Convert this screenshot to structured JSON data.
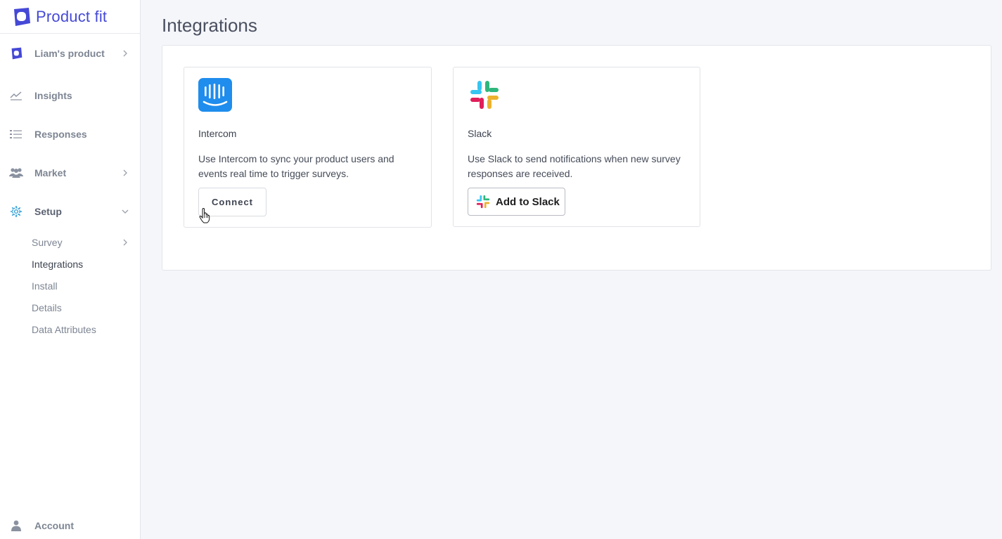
{
  "brand": {
    "name": "Product fit",
    "logo_icon": "product-fit-logo-icon",
    "color": "#4549d6"
  },
  "sidebar": {
    "items": [
      {
        "label": "Liam's product",
        "icon": "product-icon",
        "has_chevron": true
      },
      {
        "label": "Insights",
        "icon": "chart-line-icon",
        "has_chevron": false
      },
      {
        "label": "Responses",
        "icon": "list-icon",
        "has_chevron": false
      },
      {
        "label": "Market",
        "icon": "users-icon",
        "has_chevron": true
      },
      {
        "label": "Setup",
        "icon": "gear-icon",
        "has_chevron": true,
        "expanded": true
      }
    ],
    "setup_subitems": [
      {
        "label": "Survey",
        "has_chevron": true
      },
      {
        "label": "Integrations",
        "selected": true
      },
      {
        "label": "Install"
      },
      {
        "label": "Details"
      },
      {
        "label": "Data Attributes"
      }
    ],
    "account": {
      "label": "Account",
      "icon": "user-icon"
    }
  },
  "main": {
    "title": "Integrations",
    "cards": [
      {
        "name": "Intercom",
        "description": "Use Intercom to sync your product users and events real time to trigger surveys.",
        "button_label": "Connect",
        "logo_icon": "intercom-logo-icon",
        "logo_color": "#1f8ded"
      },
      {
        "name": "Slack",
        "description": "Use Slack to send notifications when new survey responses are received.",
        "button_label": "Add to Slack",
        "logo_icon": "slack-logo-icon"
      }
    ]
  },
  "colors": {
    "accent": "#4549d6",
    "setup_icon": "#2f9fd6",
    "slack_blue": "#36c5f0",
    "slack_green": "#2eb67d",
    "slack_yellow": "#ecb22e",
    "slack_red": "#e01e5a"
  }
}
